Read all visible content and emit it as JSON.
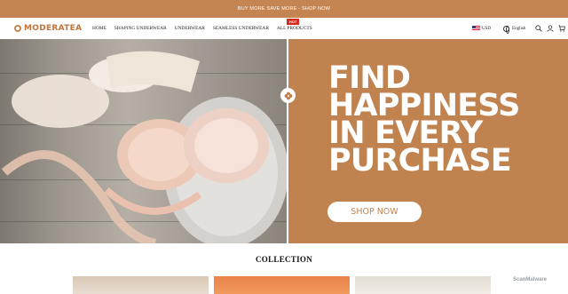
{
  "announcement": {
    "text": "BUY MORE SAVE MORE - SHOP NOW"
  },
  "header": {
    "logo": "MODERATEA",
    "nav": [
      {
        "label": "HOME"
      },
      {
        "label": "SHAPING UNDERWEAR"
      },
      {
        "label": "UNDERWEAR"
      },
      {
        "label": "SEAMLESS UNDERWEAR"
      },
      {
        "label": "ALL PRODUCTS",
        "badge": "HOT"
      }
    ],
    "currency": "USD",
    "language": "English",
    "icons": [
      "flag-us-icon",
      "globe-icon",
      "search-icon",
      "account-icon",
      "cart-icon"
    ]
  },
  "hero": {
    "headline": [
      "FIND",
      "HAPPINESS",
      "IN EVERY",
      "PURCHASE"
    ],
    "cta_label": "SHOP NOW",
    "colors": {
      "panel": "#c0834f",
      "cta_text": "#c0834f"
    }
  },
  "collection": {
    "title": "COLLECTION"
  },
  "watermark": {
    "text": "ScanMalware"
  },
  "colors": {
    "accent": "#c58553",
    "logo": "#c4733c",
    "badge": "#d72a1e"
  }
}
